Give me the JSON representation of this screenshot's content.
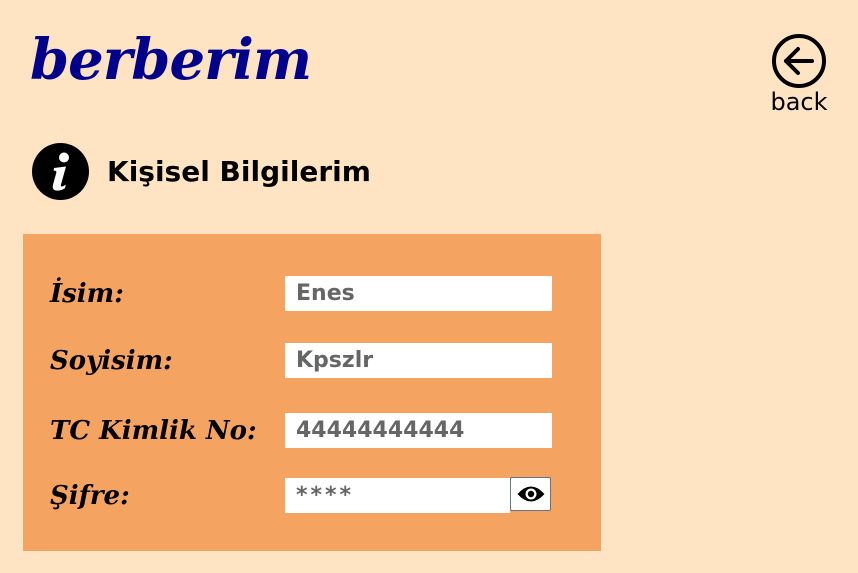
{
  "header": {
    "logo_text": "berberim",
    "back_label": "back"
  },
  "section": {
    "title": "Kişisel Bilgilerim",
    "icon": "info-icon"
  },
  "form": {
    "name_label": "İsim:",
    "name_value": "Enes",
    "surname_label": "Soyisim:",
    "surname_value": "Kpszlr",
    "tc_label": "TC Kimlik No:",
    "tc_value": "44444444444",
    "password_label": "Şifre:",
    "password_value": "****",
    "show_password_icon": "eye-icon"
  },
  "colors": {
    "background": "#FFE4C4",
    "panel": "#F4A460",
    "logo": "#00008B"
  }
}
